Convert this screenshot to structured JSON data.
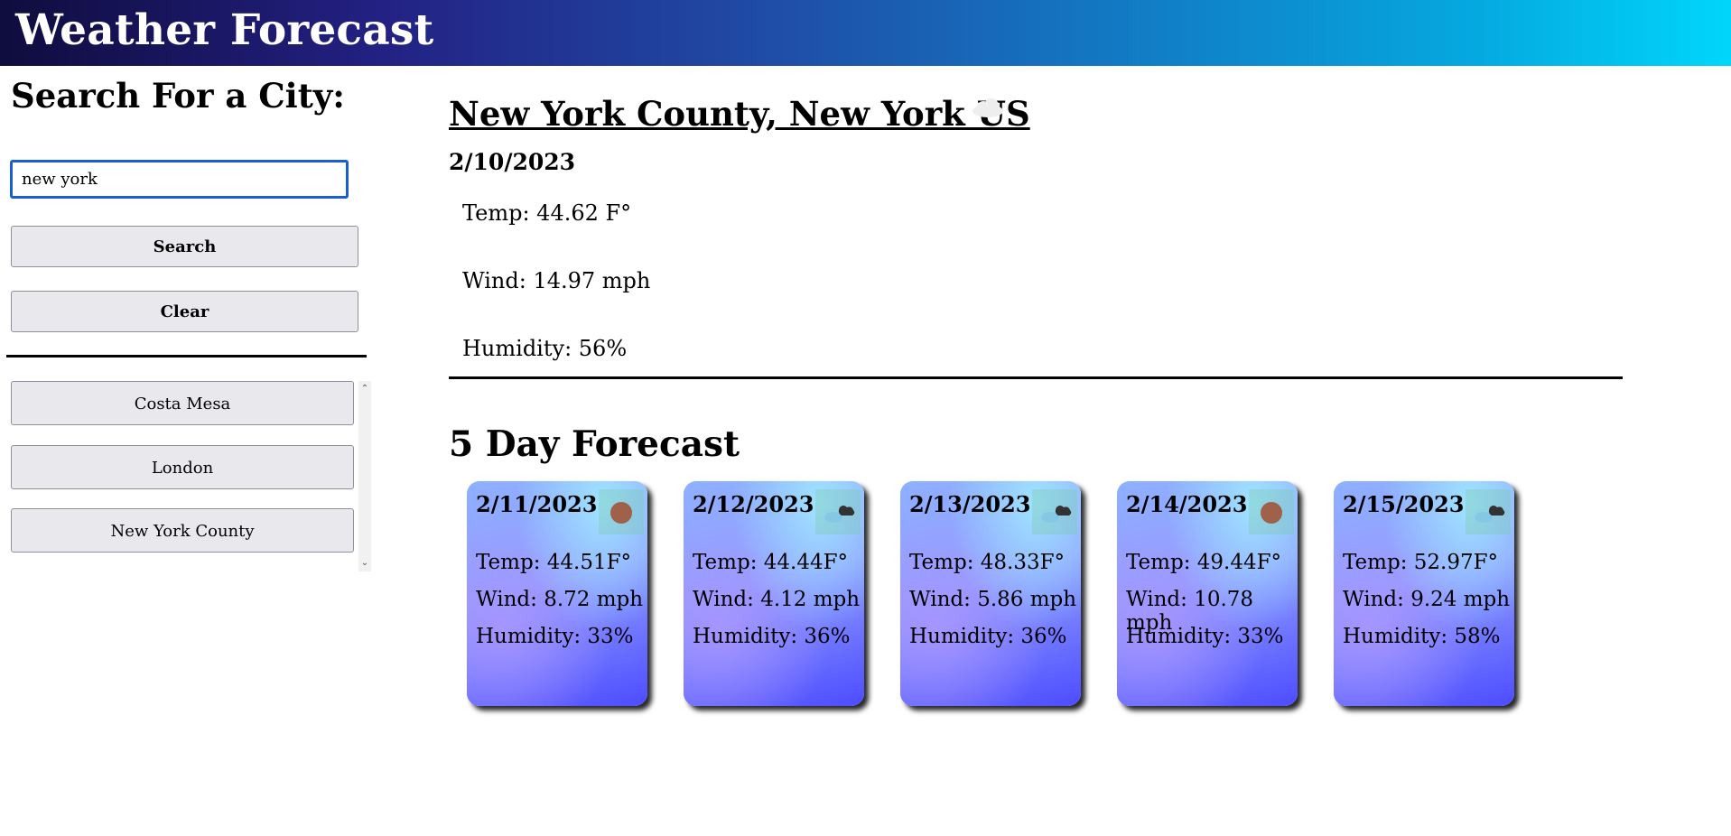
{
  "header": {
    "title": "Weather Forecast"
  },
  "sidebar": {
    "title": "Search For a City:",
    "search_value": "new york",
    "search_label": "Search",
    "clear_label": "Clear",
    "history": [
      "Costa Mesa",
      "London",
      "New York County"
    ]
  },
  "current": {
    "city": "New York County, New York US",
    "date": "2/10/2023",
    "icon": "cloud-icon",
    "temp": "Temp: 44.62 F°",
    "wind": "Wind: 14.97 mph",
    "humidity": "Humidity: 56%"
  },
  "forecast": {
    "title": "5 Day Forecast",
    "days": [
      {
        "date": "2/11/2023",
        "icon": "sun-icon",
        "temp": "Temp: 44.51F°",
        "wind": "Wind: 8.72 mph",
        "humidity": "Humidity: 33%"
      },
      {
        "date": "2/12/2023",
        "icon": "cloud-icon",
        "temp": "Temp: 44.44F°",
        "wind": "Wind: 4.12 mph",
        "humidity": "Humidity: 36%"
      },
      {
        "date": "2/13/2023",
        "icon": "cloud-icon",
        "temp": "Temp: 48.33F°",
        "wind": "Wind: 5.86 mph",
        "humidity": "Humidity: 36%"
      },
      {
        "date": "2/14/2023",
        "icon": "sun-icon",
        "temp": "Temp: 49.44F°",
        "wind": "Wind: 10.78 mph",
        "humidity": "Humidity: 33%"
      },
      {
        "date": "2/15/2023",
        "icon": "cloud-icon",
        "temp": "Temp: 52.97F°",
        "wind": "Wind: 9.24 mph",
        "humidity": "Humidity: 58%"
      }
    ]
  },
  "colors": {
    "header_start": "#0f0c3e",
    "header_end": "#00d6fb",
    "input_border": "#1a5fd1",
    "button_bg": "#e9e8ed",
    "card_bottom": "#4d4dff"
  }
}
